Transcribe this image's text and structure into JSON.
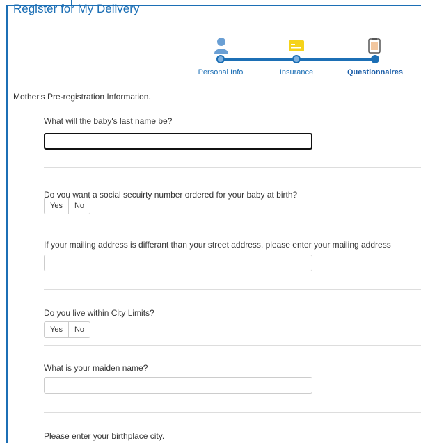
{
  "header": {
    "title": "Register for My Delivery"
  },
  "stepper": {
    "steps": [
      {
        "label": "Personal Info",
        "icon": "person-icon",
        "state": "completed"
      },
      {
        "label": "Insurance",
        "icon": "insurance-card-icon",
        "state": "completed"
      },
      {
        "label": "Questionnaires",
        "icon": "clipboard-icon",
        "state": "active"
      }
    ]
  },
  "form": {
    "section_title": "Mother's Pre-registration Information.",
    "q1": {
      "label": "What will the baby's last name be?",
      "value": ""
    },
    "q2": {
      "label": "Do you want a social secuirty number ordered for your baby at birth?",
      "yes": "Yes",
      "no": "No"
    },
    "q3": {
      "label": "If your mailing address is differant than your street address, please enter your mailing address",
      "value": ""
    },
    "q4": {
      "label": "Do you live within City Limits?",
      "yes": "Yes",
      "no": "No"
    },
    "q5": {
      "label": "What is your maiden name?",
      "value": ""
    },
    "q6": {
      "label": "Please enter your birthplace city."
    }
  },
  "colors": {
    "accent": "#1c6fb5",
    "person_icon": "#6a9fd4",
    "card_icon": "#f5d31a"
  }
}
